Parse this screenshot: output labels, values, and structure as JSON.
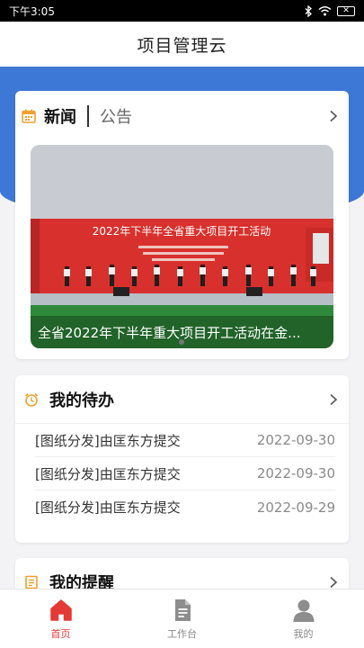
{
  "status_bar": {
    "time": "下午3:05",
    "battery": "✕"
  },
  "header": {
    "title": "项目管理云"
  },
  "news": {
    "tab_active": "新闻",
    "tab_inactive": "公告",
    "banner_caption": "全省2022年下半年重大项目开工活动在金...",
    "banner_headline": "2022年下半年全省重大项目开工活动"
  },
  "todo": {
    "title": "我的待办",
    "items": [
      {
        "text": "[图纸分发]由匡东方提交",
        "date": "2022-09-30"
      },
      {
        "text": "[图纸分发]由匡东方提交",
        "date": "2022-09-30"
      },
      {
        "text": "[图纸分发]由匡东方提交",
        "date": "2022-09-29"
      }
    ]
  },
  "reminders": {
    "title": "我的提醒"
  },
  "tabbar": {
    "items": [
      {
        "label": "首页"
      },
      {
        "label": "工作台"
      },
      {
        "label": "我的"
      }
    ]
  },
  "colors": {
    "accent": "#3d78d6",
    "active_tab": "#e53935",
    "icon_orange": "#f0a030"
  }
}
